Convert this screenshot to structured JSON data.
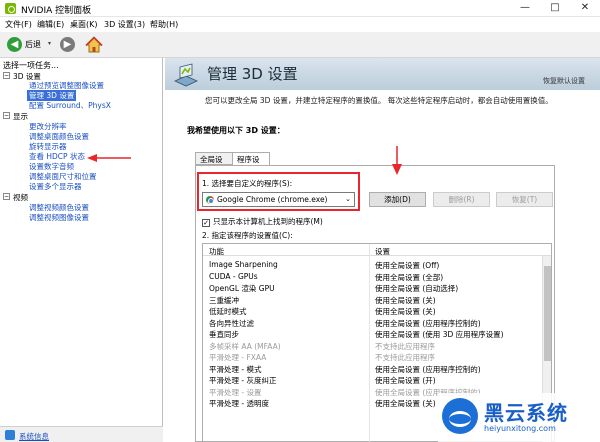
{
  "window": {
    "title": "NVIDIA 控制面板",
    "min": "—",
    "max": "□",
    "close": "✕"
  },
  "menu": [
    "文件(F)",
    "编辑(E)",
    "桌面(K)",
    "3D 设置(3)",
    "帮助(H)"
  ],
  "toolbar": {
    "back_label": "后退",
    "dropdown": "▾"
  },
  "sidebar": {
    "header": "选择一项任务...",
    "tree": [
      {
        "label": "3D 设置",
        "type": "group",
        "exp": "−"
      },
      {
        "label": "通过预览调整图像设置",
        "type": "link"
      },
      {
        "label": "管理 3D 设置",
        "type": "sel"
      },
      {
        "label": "配置 Surround、PhysX",
        "type": "link"
      },
      {
        "label": "显示",
        "type": "group",
        "exp": "−"
      },
      {
        "label": "更改分辨率",
        "type": "link"
      },
      {
        "label": "调整桌面颜色设置",
        "type": "link"
      },
      {
        "label": "旋转显示器",
        "type": "link"
      },
      {
        "label": "查看 HDCP 状态",
        "type": "link"
      },
      {
        "label": "设置数字音频",
        "type": "link"
      },
      {
        "label": "调整桌面尺寸和位置",
        "type": "link"
      },
      {
        "label": "设置多个显示器",
        "type": "link"
      },
      {
        "label": "视频",
        "type": "group",
        "exp": "−"
      },
      {
        "label": "调整视频颜色设置",
        "type": "link"
      },
      {
        "label": "调整视频图像设置",
        "type": "link"
      }
    ],
    "footer": "系统信息"
  },
  "main": {
    "title": "管理 3D 设置",
    "restore": "恢复默认设置",
    "description": "您可以更改全局 3D 设置，并建立特定程序的置换值。 每次这些特定程序启动时，都会自动使用置换值。",
    "section": "我希望使用以下 3D 设置：",
    "tabs": [
      "全局设置",
      "程序设置"
    ],
    "step1": "1. 选择要自定义的程序(S):",
    "program": "Google Chrome (chrome.exe)",
    "program_arrow": "⌄",
    "buttons": {
      "add": "添加(D)",
      "remove": "删除(R)",
      "restore": "恢复(T)"
    },
    "checkbox": {
      "label": "只显示本计算机上找到的程序(M)",
      "checked": "✓"
    },
    "step2": "2. 指定该程序的设置值(C):",
    "grid": {
      "headers": [
        "功能",
        "设置"
      ],
      "rows": [
        {
          "feature": "Image Sharpening",
          "setting": "使用全局设置 (Off)",
          "dis": false
        },
        {
          "feature": "CUDA - GPUs",
          "setting": "使用全局设置 (全部)",
          "dis": false
        },
        {
          "feature": "OpenGL 渲染 GPU",
          "setting": "使用全局设置 (自动选择)",
          "dis": false
        },
        {
          "feature": "三重缓冲",
          "setting": "使用全局设置 (关)",
          "dis": false
        },
        {
          "feature": "低延时模式",
          "setting": "使用全局设置 (关)",
          "dis": false
        },
        {
          "feature": "各向异性过滤",
          "setting": "使用全局设置 (应用程序控制的)",
          "dis": false
        },
        {
          "feature": "垂直同步",
          "setting": "使用全局设置 (使用 3D 应用程序设置)",
          "dis": false
        },
        {
          "feature": "多帧采样 AA (MFAA)",
          "setting": "不支持此应用程序",
          "dis": true
        },
        {
          "feature": "平滑处理 - FXAA",
          "setting": "不支持此应用程序",
          "dis": true
        },
        {
          "feature": "平滑处理 - 模式",
          "setting": "使用全局设置 (应用程序控制的)",
          "dis": false
        },
        {
          "feature": "平滑处理 - 灰度纠正",
          "setting": "使用全局设置 (开)",
          "dis": false
        },
        {
          "feature": "平滑处理 - 设置",
          "setting": "使用全局设置 (应用程序控制的)",
          "dis": true
        },
        {
          "feature": "平滑处理 - 透明度",
          "setting": "使用全局设置 (关)",
          "dis": false
        }
      ]
    }
  },
  "watermark": {
    "text": "黑云系统",
    "url": "heiyunxitong.com"
  },
  "colors": {
    "accent": "#76b900",
    "highlight": "#e8262c",
    "link": "#1a4fc4"
  }
}
